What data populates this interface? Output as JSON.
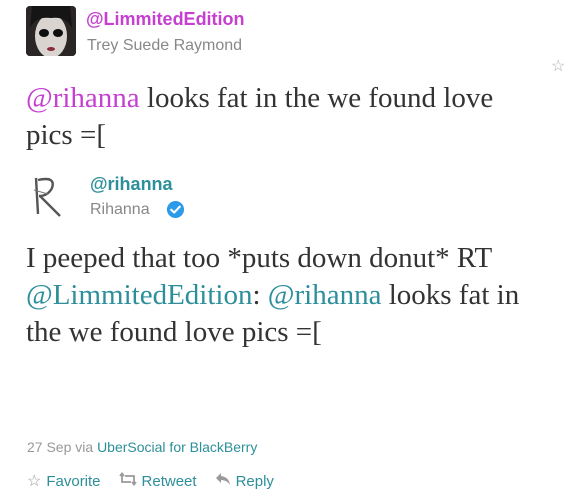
{
  "tweet1": {
    "handle": "@LimmitedEdition",
    "display_name": "Trey Suede Raymond",
    "text_mention": "@rihanna",
    "text_rest": " looks fat in the we found love pics =["
  },
  "tweet2": {
    "handle": "@rihanna",
    "display_name": "Rihanna",
    "verified": true,
    "text_start": "I peeped that too *puts down donut* RT ",
    "text_mention1": "@LimmitedEdition",
    "text_colon": ":",
    "text_mention2": "@rihanna",
    "text_end": " looks fat in the we found love pics =["
  },
  "meta": {
    "date": "27 Sep",
    "via": "via",
    "app": "UberSocial for BlackBerry"
  },
  "actions": {
    "favorite": "Favorite",
    "retweet": "Retweet",
    "reply": "Reply"
  },
  "icons": {
    "favorite_top": "star-icon",
    "favorite": "star-icon",
    "retweet": "retweet-icon",
    "reply": "reply-icon",
    "verified": "verified-badge-icon"
  },
  "colors": {
    "mention_purple": "#c53fd0",
    "link_teal": "#2d8f9a",
    "verified_blue": "#2b9ae8"
  }
}
